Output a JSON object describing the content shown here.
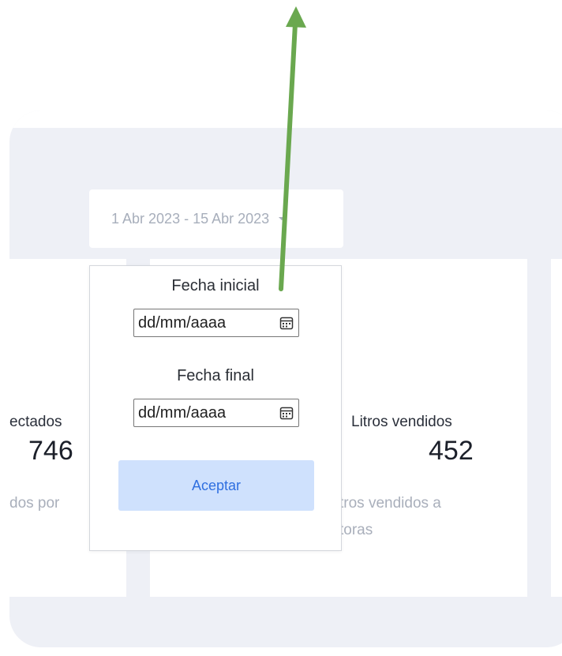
{
  "date_range": {
    "label": "1 Abr 2023 - 15 Abr 2023"
  },
  "stats": {
    "left": {
      "label": "ectados",
      "value": "746",
      "desc": "dos por"
    },
    "right": {
      "label": "Litros vendidos",
      "value": "452",
      "desc_line1": "tros vendidos a",
      "desc_line2": "toras"
    }
  },
  "popover": {
    "start_label": "Fecha inicial",
    "start_placeholder": "dd/mm/aaaa",
    "end_label": "Fecha final",
    "end_placeholder": "dd/mm/aaaa",
    "accept_label": "Aceptar"
  },
  "icons": {
    "calendar": "calendar-icon",
    "caret": "chevron-down-icon",
    "arrow": "arrow-up-icon"
  },
  "colors": {
    "arrow": "#6aa84f",
    "accept_bg": "#cfe1fd",
    "accept_text": "#2f6fe0"
  }
}
